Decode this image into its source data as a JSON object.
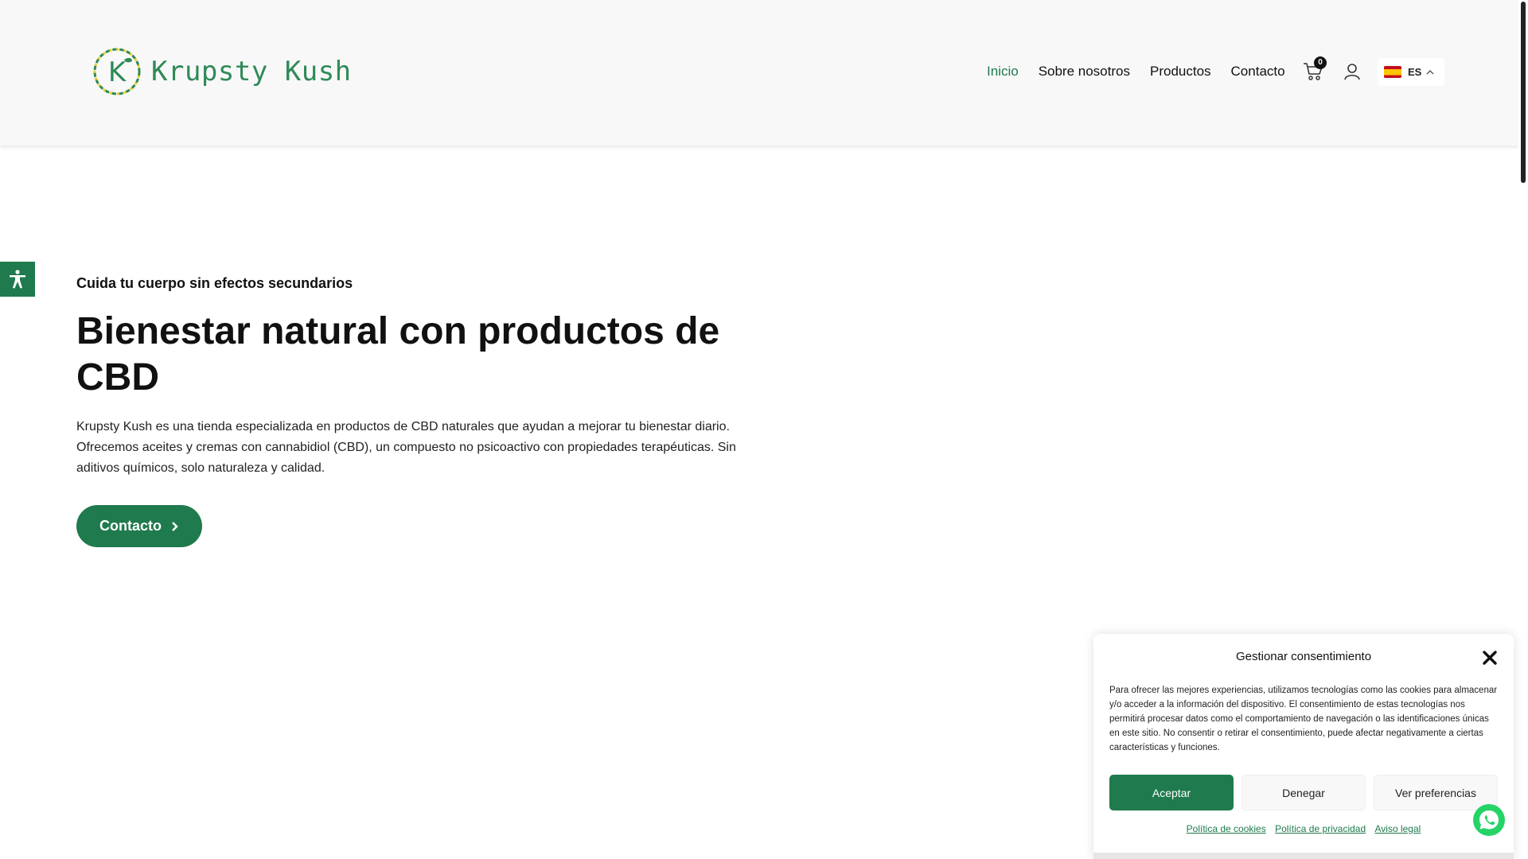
{
  "brand": {
    "name": "Krupsty Kush",
    "accent": "#1f7a4d"
  },
  "nav": {
    "items": [
      {
        "label": "Inicio"
      },
      {
        "label": "Sobre nosotros"
      },
      {
        "label": "Productos"
      },
      {
        "label": "Contacto"
      }
    ],
    "cart_count": "0",
    "language": "ES"
  },
  "hero": {
    "eyebrow": "Cuida tu cuerpo sin efectos secundarios",
    "title": "Bienestar natural con productos de CBD",
    "text": "Krupsty Kush es una tienda especializada en productos de CBD naturales que ayudan a mejorar tu bienestar diario. Ofrecemos aceites y cremas con cannabidiol (CBD), un compuesto no psicoactivo con propiedades terapéuticas. Sin aditivos químicos, solo naturaleza y calidad.",
    "cta_label": "Contacto"
  },
  "consent": {
    "title": "Gestionar consentimiento",
    "text": "Para ofrecer las mejores experiencias, utilizamos tecnologías como las cookies para almacenar y/o acceder a la información del dispositivo. El consentimiento de estas tecnologías nos permitirá procesar datos como el comportamiento de navegación o las identificaciones únicas en este sitio. No consentir o retirar el consentimiento, puede afectar negativamente a ciertas características y funciones.",
    "accept": "Aceptar",
    "deny": "Denegar",
    "preferences": "Ver preferencias",
    "links": [
      "Política de cookies",
      "Política de privacidad",
      "Aviso legal"
    ]
  }
}
